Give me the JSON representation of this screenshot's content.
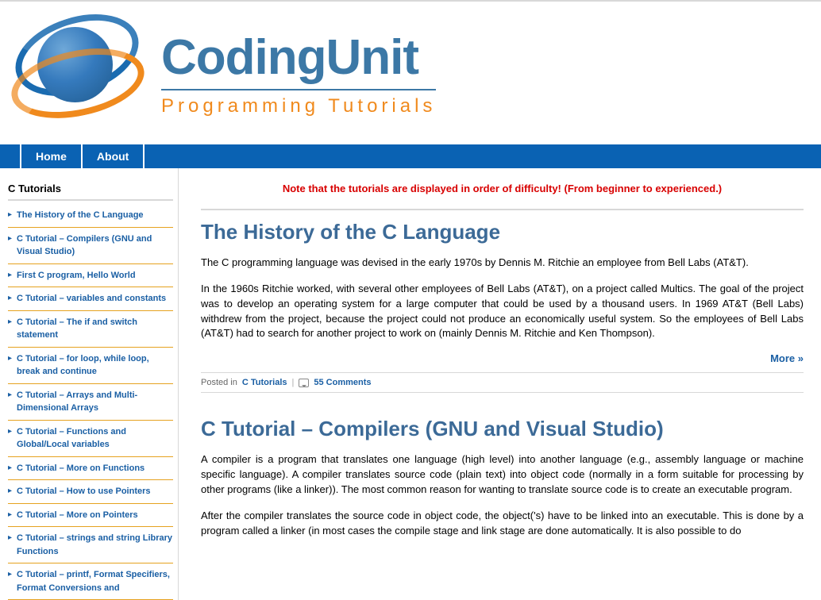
{
  "brand": {
    "name": "CodingUnit",
    "tagline": "Programming Tutorials"
  },
  "nav": {
    "home": "Home",
    "about": "About"
  },
  "sidebar": {
    "title": "C Tutorials",
    "items": [
      "The History of the C Language",
      "C Tutorial – Compilers (GNU and Visual Studio)",
      "First C program, Hello World",
      "C Tutorial – variables and constants",
      "C Tutorial – The if and switch statement",
      "C Tutorial – for loop, while loop, break and continue",
      "C Tutorial – Arrays and Multi-Dimensional Arrays",
      "C Tutorial – Functions and Global/Local variables",
      "C Tutorial – More on Functions",
      "C Tutorial – How to use Pointers",
      "C Tutorial – More on Pointers",
      "C Tutorial – strings and string Library Functions",
      "C Tutorial – printf, Format Specifiers, Format Conversions and"
    ]
  },
  "notice": "Note that the tutorials are displayed in order of difficulty! (From beginner to experienced.)",
  "posts": [
    {
      "title": "The History of the C Language",
      "paragraphs": [
        "The C programming language was devised in the early 1970s by Dennis M. Ritchie an employee from Bell Labs (AT&T).",
        "In the 1960s Ritchie worked, with several other employees of Bell Labs (AT&T), on a project called Multics. The goal of the project was to develop an operating system for a large computer that could be used by a thousand users. In 1969 AT&T (Bell Labs) withdrew from the project, because the project could not produce an economically useful system. So the employees of Bell Labs (AT&T) had to search for another project to work on (mainly Dennis M. Ritchie and Ken Thompson)."
      ],
      "more_label": "More »",
      "meta": {
        "posted_in_label": "Posted in",
        "category": "C Tutorials",
        "comments": "55 Comments"
      }
    },
    {
      "title": "C Tutorial – Compilers (GNU and Visual Studio)",
      "paragraphs": [
        "A compiler is a program that translates one language (high level) into another language (e.g., assembly language or machine specific language). A compiler translates source code (plain text) into object code (normally in a form suitable for processing by other programs (like a linker)). The most common reason for wanting to translate source code is to create an executable program.",
        "After the compiler translates the source code in object code, the object('s) have to be linked into an executable. This is done by a program called a linker (in most cases the compile stage and link stage are done automatically. It is also possible to do"
      ]
    }
  ]
}
